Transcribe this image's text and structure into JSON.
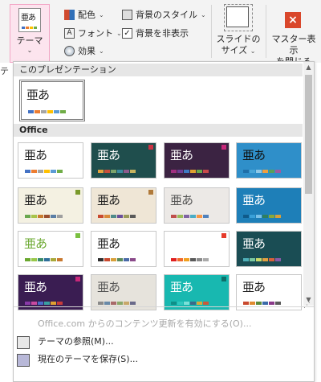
{
  "ribbon": {
    "theme_icon_text": "亜あ",
    "theme_label": "テーマ",
    "colors_label": "配色",
    "fonts_label": "フォント",
    "effects_label": "効果",
    "bg_style_label": "背景のスタイル",
    "hide_bg_label": "背景を非表示",
    "slide_size_line1": "スライドの",
    "slide_size_line2": "サイズ",
    "close_master_line1": "マスター表示",
    "close_master_line2": "を閉じる",
    "close_icon": "×",
    "tab_fragment": "テ",
    "accent_close_color": "#d9472b"
  },
  "panel": {
    "section_current": "このプレゼンテーション",
    "section_office": "Office",
    "current_theme": {
      "title": "亜あ",
      "bg": "#ffffff",
      "fg": "#222222",
      "bars": [
        "#4472c4",
        "#ed7d31",
        "#a5a5a5",
        "#ffc000",
        "#5b9bd5",
        "#70ad47"
      ]
    },
    "themes": [
      {
        "title": "亜あ",
        "bg": "#ffffff",
        "fg": "#222222",
        "bars": [
          "#4472c4",
          "#ed7d31",
          "#a5a5a5",
          "#ffc000",
          "#5b9bd5",
          "#70ad47"
        ],
        "accent": ""
      },
      {
        "title": "亜あ",
        "bg": "#1f4e4d",
        "fg": "#ffffff",
        "bars": [
          "#e2a33e",
          "#c94f3b",
          "#7ba36b",
          "#3a8ca0",
          "#8c5a8c",
          "#c7b35e"
        ],
        "accent": "#cc3344"
      },
      {
        "title": "亜あ",
        "bg": "#3b2342",
        "fg": "#ffffff",
        "bars": [
          "#a02f7f",
          "#6f3d94",
          "#3f7ac2",
          "#e0a130",
          "#6aaa4a",
          "#c84a4a"
        ],
        "accent": "#c8287a"
      },
      {
        "title": "亜あ",
        "bg": "#2f8fc9",
        "fg": "#111111",
        "bars": [
          "#1f6fa8",
          "#48a6d8",
          "#8fc8e6",
          "#f0a040",
          "#5aa05a",
          "#a05aa0"
        ],
        "accent": ""
      },
      {
        "title": "亜あ",
        "bg": "#f4f1e2",
        "fg": "#222222",
        "bars": [
          "#6aa84f",
          "#a8c44a",
          "#c97c2f",
          "#9a4f2f",
          "#5b7fa6",
          "#9f9f9f"
        ],
        "accent": "#7a9a2a"
      },
      {
        "title": "亜あ",
        "bg": "#efe6d6",
        "fg": "#222222",
        "bars": [
          "#c94a2f",
          "#d98a3a",
          "#4f8a8a",
          "#6a4f9a",
          "#9a9a5a",
          "#5a5a5a"
        ],
        "accent": "#b07a3a"
      },
      {
        "title": "亜あ",
        "bg": "#ece9e6",
        "fg": "#555555",
        "bars": [
          "#c0504d",
          "#9bbb59",
          "#8064a2",
          "#4bacc6",
          "#f79646",
          "#4f81bd"
        ],
        "accent": ""
      },
      {
        "title": "亜あ",
        "bg": "#1e7fb8",
        "fg": "#ffffff",
        "bars": [
          "#0f5a8a",
          "#3aa0d8",
          "#7ac0e6",
          "#2f7f5f",
          "#8aa83a",
          "#d8a03a"
        ],
        "accent": ""
      },
      {
        "title": "亜あ",
        "bg": "#ffffff",
        "fg": "#6aa82f",
        "bars": [
          "#6aa82f",
          "#98c84a",
          "#3a8a6a",
          "#2f6f9a",
          "#a8a83a",
          "#c8782f"
        ],
        "accent": "#7ac040"
      },
      {
        "title": "亜あ",
        "bg": "#ffffff",
        "fg": "#222222",
        "bars": [
          "#2f2f2f",
          "#c94a2f",
          "#d8a03a",
          "#5a8a5a",
          "#4a6aa8",
          "#8a4a8a"
        ],
        "accent": ""
      },
      {
        "title": "亜あ",
        "bg": "#ffffff",
        "fg": "#ffffff",
        "bars": [
          "#e02020",
          "#f06a2a",
          "#f0a020",
          "#5a5a5a",
          "#8a8a8a",
          "#aaaaaa"
        ],
        "accent": "#e63a2a"
      },
      {
        "title": "亜あ",
        "bg": "#1a4d54",
        "fg": "#ffffff",
        "bars": [
          "#4fb0b8",
          "#7ac8a0",
          "#c8d86a",
          "#e0a040",
          "#d8603a",
          "#8a5aa8"
        ],
        "accent": ""
      },
      {
        "title": "亜あ",
        "bg": "#3a1d52",
        "fg": "#ffffff",
        "bars": [
          "#8a3aa8",
          "#c84aa0",
          "#4a6ac8",
          "#3aa0a0",
          "#e0a030",
          "#c83a3a"
        ],
        "accent": "#c8287a"
      },
      {
        "title": "亜あ",
        "bg": "#e6e3dc",
        "fg": "#555555",
        "bars": [
          "#8a8a8a",
          "#6a8aa8",
          "#a86a6a",
          "#8aa86a",
          "#c8a86a",
          "#6a6a8a"
        ],
        "accent": ""
      },
      {
        "title": "亜あ",
        "bg": "#18b8b0",
        "fg": "#ffffff",
        "bars": [
          "#0f8f88",
          "#2fc8c0",
          "#7ae0d8",
          "#3a6a8a",
          "#d8a83a",
          "#c85a3a"
        ],
        "accent": "#0e6f6a"
      },
      {
        "title": "亜あ",
        "bg": "#ffffff",
        "fg": "#222222",
        "bars": [
          "#c94a2f",
          "#e08a2f",
          "#5a8a3a",
          "#3a6aa8",
          "#8a3a8a",
          "#5a5a5a"
        ],
        "accent": ""
      }
    ],
    "menu_update": "Office.com からのコンテンツ更新を有効にする(O)...",
    "menu_browse": "テーマの参照(M)...",
    "menu_save": "現在のテーマを保存(S)..."
  }
}
